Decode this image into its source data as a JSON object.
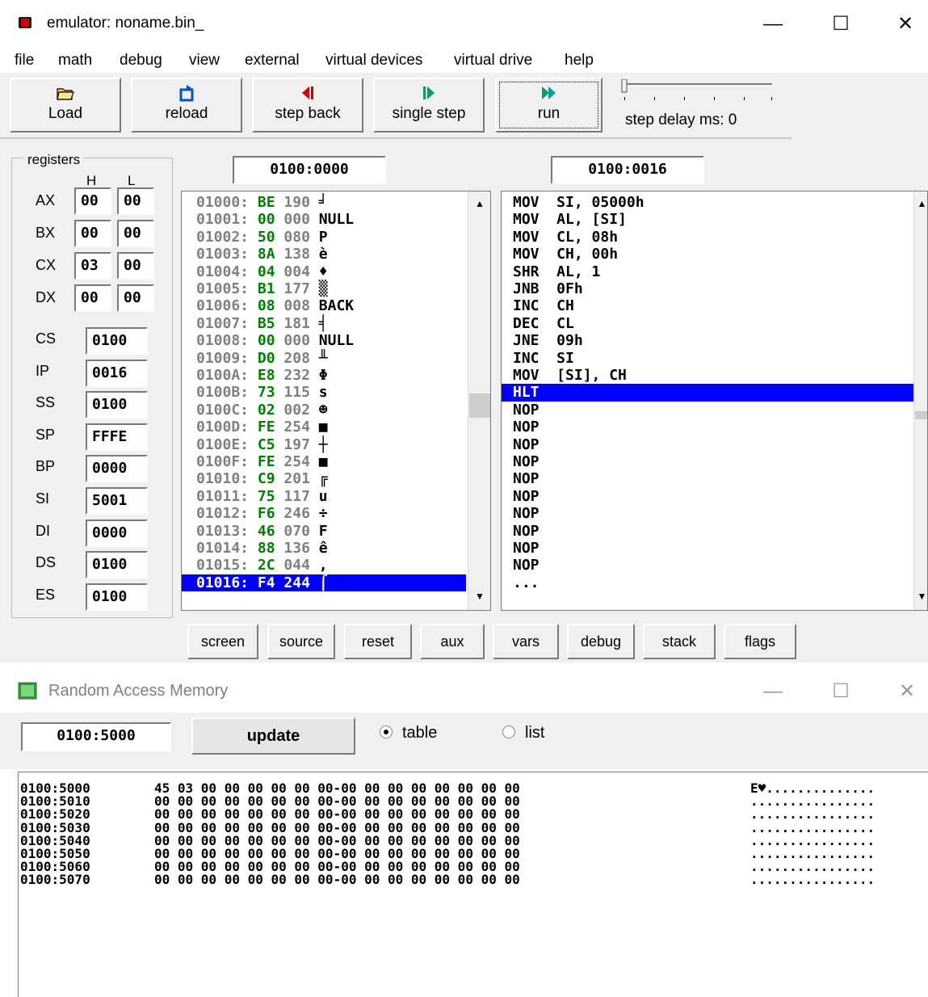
{
  "window": {
    "title": "emulator: noname.bin_",
    "minimize": "—",
    "maximize": "☐",
    "close": "✕"
  },
  "menu": [
    "file",
    "math",
    "debug",
    "view",
    "external",
    "virtual devices",
    "virtual drive",
    "help"
  ],
  "toolbar": {
    "load": "Load",
    "reload": "reload",
    "step_back": "step back",
    "single_step": "single step",
    "run": "run",
    "step_delay": "step delay ms: 0",
    "step_delay_value": 0
  },
  "registers": {
    "legend": "registers",
    "h": "H",
    "l": "L",
    "general": [
      {
        "name": "AX",
        "h": "00",
        "l": "00"
      },
      {
        "name": "BX",
        "h": "00",
        "l": "00"
      },
      {
        "name": "CX",
        "h": "03",
        "l": "00"
      },
      {
        "name": "DX",
        "h": "00",
        "l": "00"
      }
    ],
    "segment": [
      {
        "name": "CS",
        "value": "0100"
      },
      {
        "name": "IP",
        "value": "0016"
      },
      {
        "name": "SS",
        "value": "0100"
      },
      {
        "name": "SP",
        "value": "FFFE"
      },
      {
        "name": "BP",
        "value": "0000"
      },
      {
        "name": "SI",
        "value": "5001"
      },
      {
        "name": "DI",
        "value": "0000"
      },
      {
        "name": "DS",
        "value": "0100"
      },
      {
        "name": "ES",
        "value": "0100"
      }
    ]
  },
  "memory_address": "0100:0000",
  "disasm_address": "0100:0016",
  "memory_list": [
    {
      "addr": "01000:",
      "hex": "BE",
      "dec": "190",
      "chr": "╛"
    },
    {
      "addr": "01001:",
      "hex": "00",
      "dec": "000",
      "chr": "NULL"
    },
    {
      "addr": "01002:",
      "hex": "50",
      "dec": "080",
      "chr": "P"
    },
    {
      "addr": "01003:",
      "hex": "8A",
      "dec": "138",
      "chr": "è"
    },
    {
      "addr": "01004:",
      "hex": "04",
      "dec": "004",
      "chr": "♦"
    },
    {
      "addr": "01005:",
      "hex": "B1",
      "dec": "177",
      "chr": "▒"
    },
    {
      "addr": "01006:",
      "hex": "08",
      "dec": "008",
      "chr": "BACK"
    },
    {
      "addr": "01007:",
      "hex": "B5",
      "dec": "181",
      "chr": "╡"
    },
    {
      "addr": "01008:",
      "hex": "00",
      "dec": "000",
      "chr": "NULL"
    },
    {
      "addr": "01009:",
      "hex": "D0",
      "dec": "208",
      "chr": "╨"
    },
    {
      "addr": "0100A:",
      "hex": "E8",
      "dec": "232",
      "chr": "Φ"
    },
    {
      "addr": "0100B:",
      "hex": "73",
      "dec": "115",
      "chr": "s"
    },
    {
      "addr": "0100C:",
      "hex": "02",
      "dec": "002",
      "chr": "☻"
    },
    {
      "addr": "0100D:",
      "hex": "FE",
      "dec": "254",
      "chr": "■"
    },
    {
      "addr": "0100E:",
      "hex": "C5",
      "dec": "197",
      "chr": "┼"
    },
    {
      "addr": "0100F:",
      "hex": "FE",
      "dec": "254",
      "chr": "■"
    },
    {
      "addr": "01010:",
      "hex": "C9",
      "dec": "201",
      "chr": "╔"
    },
    {
      "addr": "01011:",
      "hex": "75",
      "dec": "117",
      "chr": "u"
    },
    {
      "addr": "01012:",
      "hex": "F6",
      "dec": "246",
      "chr": "÷"
    },
    {
      "addr": "01013:",
      "hex": "46",
      "dec": "070",
      "chr": "F"
    },
    {
      "addr": "01014:",
      "hex": "88",
      "dec": "136",
      "chr": "ê"
    },
    {
      "addr": "01015:",
      "hex": "2C",
      "dec": "044",
      "chr": ","
    },
    {
      "addr": "01016:",
      "hex": "F4",
      "dec": "244",
      "chr": "⌠",
      "selected": true
    }
  ],
  "disassembly": [
    "MOV  SI, 05000h",
    "MOV  AL, [SI]",
    "MOV  CL, 08h",
    "MOV  CH, 00h",
    "SHR  AL, 1",
    "JNB  0Fh",
    "INC  CH",
    "DEC  CL",
    "JNE  09h",
    "INC  SI",
    "MOV  [SI], CH",
    "HLT",
    "NOP",
    "NOP",
    "NOP",
    "NOP",
    "NOP",
    "NOP",
    "NOP",
    "NOP",
    "NOP",
    "NOP",
    "..."
  ],
  "disasm_selected_index": 11,
  "bottom_buttons": [
    "screen",
    "source",
    "reset",
    "aux",
    "vars",
    "debug",
    "stack",
    "flags"
  ],
  "ram": {
    "title": "Random Access Memory",
    "address": "0100:5000",
    "update": "update",
    "table": "table",
    "list": "list",
    "view_mode": "table",
    "rows": [
      {
        "addr": "0100:5000",
        "bytes": "45 03 00 00 00 00 00 00-00 00 00 00 00 00 00 00",
        "ascii": "E♥.............."
      },
      {
        "addr": "0100:5010",
        "bytes": "00 00 00 00 00 00 00 00-00 00 00 00 00 00 00 00",
        "ascii": "................"
      },
      {
        "addr": "0100:5020",
        "bytes": "00 00 00 00 00 00 00 00-00 00 00 00 00 00 00 00",
        "ascii": "................"
      },
      {
        "addr": "0100:5030",
        "bytes": "00 00 00 00 00 00 00 00-00 00 00 00 00 00 00 00",
        "ascii": "................"
      },
      {
        "addr": "0100:5040",
        "bytes": "00 00 00 00 00 00 00 00-00 00 00 00 00 00 00 00",
        "ascii": "................"
      },
      {
        "addr": "0100:5050",
        "bytes": "00 00 00 00 00 00 00 00-00 00 00 00 00 00 00 00",
        "ascii": "................"
      },
      {
        "addr": "0100:5060",
        "bytes": "00 00 00 00 00 00 00 00-00 00 00 00 00 00 00 00",
        "ascii": "................"
      },
      {
        "addr": "0100:5070",
        "bytes": "00 00 00 00 00 00 00 00-00 00 00 00 00 00 00 00",
        "ascii": "................"
      }
    ]
  }
}
